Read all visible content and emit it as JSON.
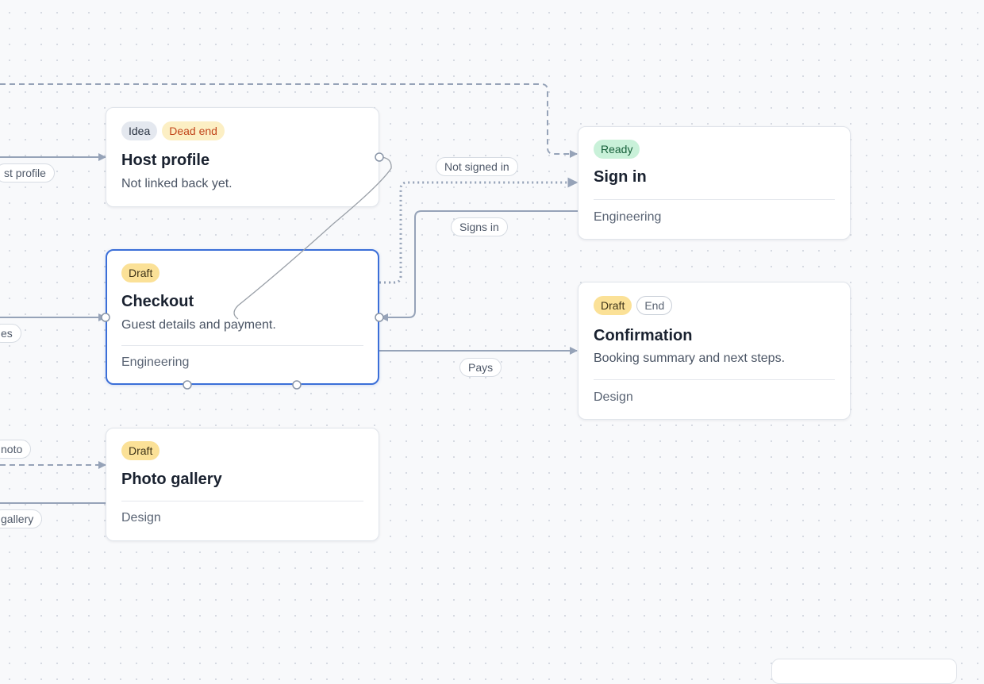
{
  "nodes": {
    "host_profile": {
      "tags": [
        "Idea",
        "Dead end"
      ],
      "title": "Host profile",
      "desc": "Not linked back yet."
    },
    "sign_in": {
      "tags": [
        "Ready"
      ],
      "title": "Sign in",
      "team": "Engineering"
    },
    "checkout": {
      "tags": [
        "Draft"
      ],
      "title": "Checkout",
      "desc": "Guest details and payment.",
      "team": "Engineering"
    },
    "confirmation": {
      "tags": [
        "Draft",
        "End"
      ],
      "title": "Confirmation",
      "desc": "Booking summary and next steps.",
      "team": "Design"
    },
    "photo_gallery": {
      "tags": [
        "Draft"
      ],
      "title": "Photo gallery",
      "team": "Design"
    }
  },
  "edge_labels": {
    "host_profile_partial": "st profile",
    "not_signed_in": "Not signed in",
    "signs_in": "Signs in",
    "partial_es": "es",
    "pays": "Pays",
    "partial_photo": "noto",
    "partial_gallery": "gallery"
  },
  "colors": {
    "edge": "#96a3b8",
    "selection": "#3b6fd8",
    "connection_drag": "#9aa0a8"
  }
}
